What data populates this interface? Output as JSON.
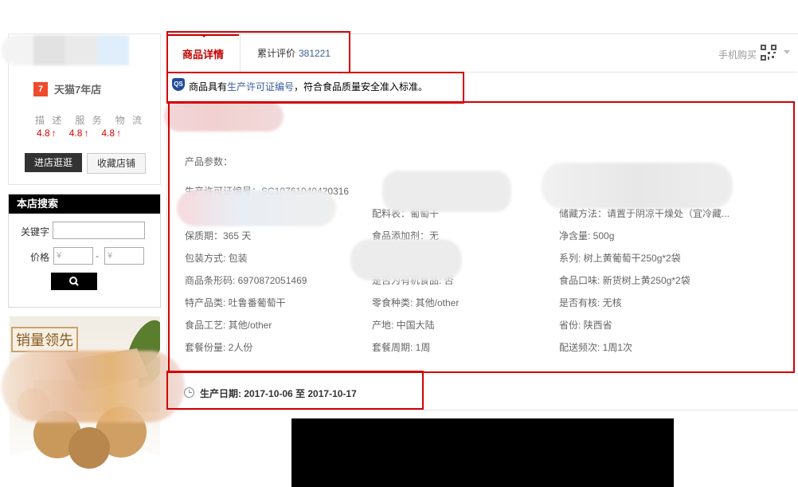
{
  "shop": {
    "tmall_badge": "7",
    "tmall_years": "天猫7年店",
    "dsr_labels": [
      "描 述",
      "服 务",
      "物 流"
    ],
    "dsr_scores": [
      "4.8",
      "4.8",
      "4.8"
    ],
    "enter_button": "进店逛逛",
    "favorite_button": "收藏店铺"
  },
  "store_search": {
    "title": "本店搜索",
    "keyword_label": "关键字",
    "price_label": "价格",
    "price_min_placeholder": "¥",
    "price_max_placeholder": "¥",
    "price_separator": "-"
  },
  "promo": {
    "tag": "销量领先"
  },
  "tabs": {
    "detail": "商品详情",
    "reviews_label": "累计评价",
    "reviews_count": "381221",
    "mobile_buy": "手机购买"
  },
  "qs_notice": {
    "icon_text": "QS",
    "prefix": "商品具有",
    "link": "生产许可证编号",
    "suffix": "，符合食品质量安全准入标准。"
  },
  "params": {
    "title": "产品参数：",
    "license": "生产许可证编号：SC10761040420316",
    "rows": [
      [
        "保质期：365 天",
        "配料表：葡萄干",
        "储藏方法：请置于阴凉干燥处（宜冷藏..."
      ],
      [
        "",
        "食品添加剂：无",
        "净含量: 500g"
      ],
      [
        "包装方式: 包装",
        "",
        "系列: 树上黄葡萄干250g*2袋"
      ],
      [
        "商品条形码: 6970872051469",
        "是否为有机食品: 否",
        "食品口味: 新货树上黄250g*2袋"
      ],
      [
        "特产品类: 吐鲁番葡萄干",
        "零食种类: 其他/other",
        "是否有核: 无核"
      ],
      [
        "食品工艺: 其他/other",
        "产地: 中国大陆",
        "省份: 陕西省"
      ],
      [
        "套餐份量: 2人份",
        "套餐周期: 1周",
        "配送频次: 1周1次"
      ]
    ]
  },
  "production_date": "生产日期: 2017-10-06 至 2017-10-17",
  "colors": {
    "accent": "#c40000",
    "link": "#3a5d9d",
    "dsr": "#dd0000",
    "highlight_box": "#d40000"
  }
}
